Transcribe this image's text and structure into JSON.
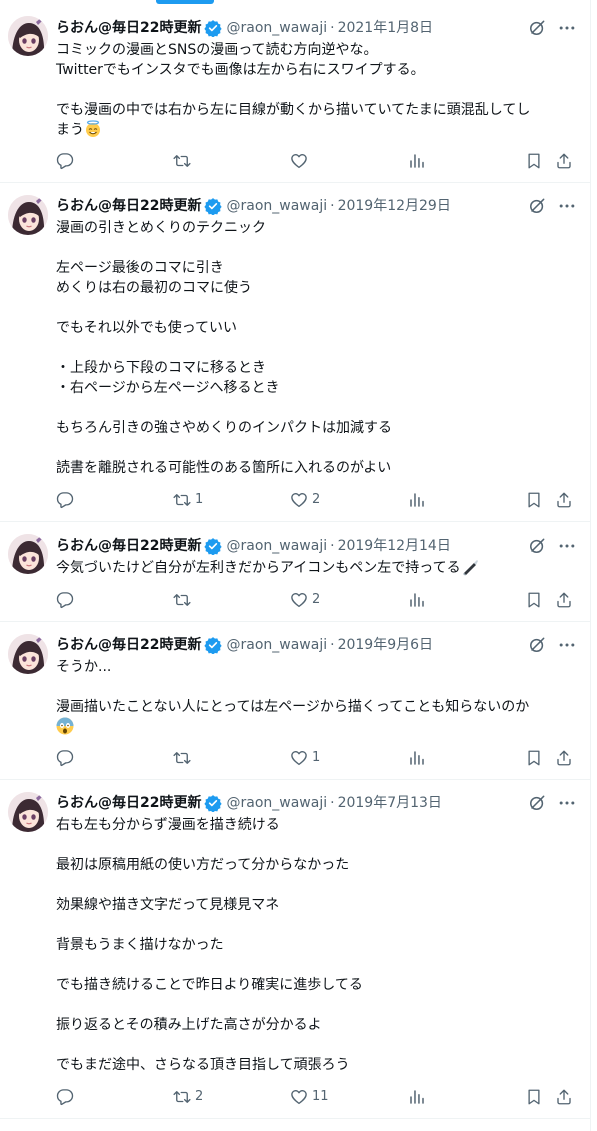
{
  "user": {
    "name": "らおん@毎日22時更新",
    "handle": "@raon_wawaji"
  },
  "separator": "·",
  "tweets": [
    {
      "date": "2021年1月8日",
      "lines": [
        "コミックの漫画とSNSの漫画って読む方向逆やな。",
        "Twitterでもインスタでも画像は左から右にスワイプする。",
        "",
        "でも漫画の中では右から左に目線が動くから描いていてたまに頭混乱してし",
        "まう"
      ],
      "emoji": "smiling-face-with-halo",
      "reply_count": "",
      "retweet_count": "",
      "like_count": ""
    },
    {
      "date": "2019年12月29日",
      "lines": [
        "漫画の引きとめくりのテクニック",
        "",
        "左ページ最後のコマに引き",
        "めくりは右の最初のコマに使う",
        "",
        "でもそれ以外でも使っていい",
        "",
        "・上段から下段のコマに移るとき",
        "・右ページから左ページへ移るとき",
        "",
        "もちろん引きの強さやめくりのインパクトは加減する",
        "",
        "読書を離脱される可能性のある箇所に入れるのがよい"
      ],
      "reply_count": "",
      "retweet_count": "1",
      "like_count": "2"
    },
    {
      "date": "2019年12月14日",
      "lines": [
        "今気づいたけど自分が左利きだからアイコンもペン左で持ってる"
      ],
      "emoji": "fountain-pen",
      "reply_count": "",
      "retweet_count": "",
      "like_count": "2"
    },
    {
      "date": "2019年9月6日",
      "lines": [
        "そうか...",
        "",
        "漫画描いたことない人にとっては左ページから描くってことも知らないのか",
        ""
      ],
      "emoji": "face-screaming-in-fear",
      "reply_count": "",
      "retweet_count": "",
      "like_count": "1"
    },
    {
      "date": "2019年7月13日",
      "lines": [
        "右も左も分からず漫画を描き続ける",
        "",
        "最初は原稿用紙の使い方だって分からなかった",
        "",
        "効果線や描き文字だって見様見マネ",
        "",
        "背景もうまく描けなかった",
        "",
        "でも描き続けることで昨日より確実に進歩してる",
        "",
        "振り返るとその積み上げた高さが分かるよ",
        "",
        "でもまだ途中、さらなる頂き目指して頑張ろう"
      ],
      "reply_count": "",
      "retweet_count": "2",
      "like_count": "11"
    }
  ],
  "colors": {
    "accent": "#1d9bf0",
    "text": "#0f1419",
    "secondary": "#536471",
    "border": "#eff3f4"
  }
}
